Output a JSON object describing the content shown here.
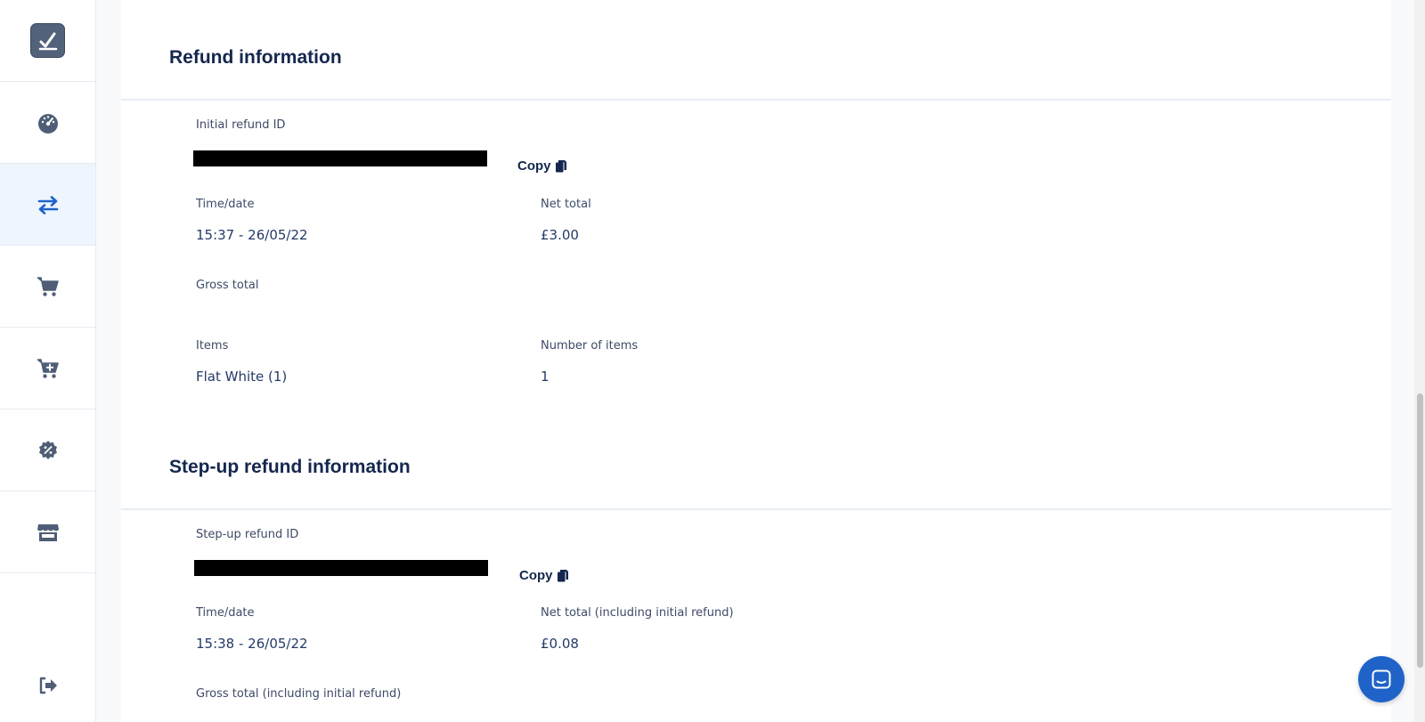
{
  "sidebar": {
    "logo_icon": "checkmark-logo-icon",
    "items": [
      {
        "icon": "dashboard-gauge-icon",
        "active": false
      },
      {
        "icon": "transactions-arrows-icon",
        "active": true
      },
      {
        "icon": "cart-icon",
        "active": false
      },
      {
        "icon": "cart-plus-icon",
        "active": false
      },
      {
        "icon": "discount-badge-icon",
        "active": false
      },
      {
        "icon": "store-icon",
        "active": false
      }
    ],
    "logout_icon": "logout-icon"
  },
  "refund": {
    "title": "Refund information",
    "id_label": "Initial refund ID",
    "copy_label": "Copy",
    "time_label": "Time/date",
    "time_value": "15:37 - 26/05/22",
    "net_label": "Net total",
    "net_value": "£3.00",
    "gross_label": "Gross total",
    "items_label": "Items",
    "items_value": "Flat White (1)",
    "count_label": "Number of items",
    "count_value": "1"
  },
  "stepup": {
    "title": "Step-up refund information",
    "id_label": "Step-up refund ID",
    "copy_label": "Copy",
    "time_label": "Time/date",
    "time_value": "15:38 - 26/05/22",
    "net_label": "Net total (including initial refund)",
    "net_value": "£0.08",
    "gross_label": "Gross total (including initial refund)"
  },
  "colors": {
    "accent": "#1f63c9",
    "title": "#15274e",
    "active_nav_bg": "#eef5fd"
  },
  "chat_icon": "chat-icon"
}
